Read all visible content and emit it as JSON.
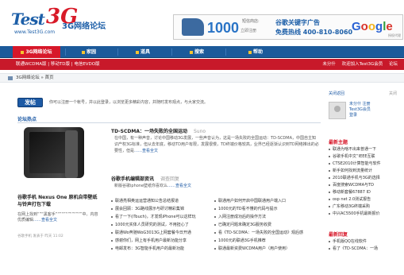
{
  "header": {
    "logo_main": "Test",
    "logo_x": "3G",
    "logo_url": "www.Test3G.com",
    "site_title": "3G网络论坛"
  },
  "banner": {
    "big_number": "1000",
    "tag_top": "短信商店:",
    "tag_bottom": "立即注册",
    "google_title": "谷歌关键字广告",
    "hotline": "免费热线 400-810-8060",
    "google_sub": "授权代理"
  },
  "nav": {
    "items": [
      "3G网络论坛",
      "家园",
      "道具",
      "搜索",
      "帮助"
    ],
    "active_index": 0
  },
  "subnav": {
    "left": "联通WCDMA版 | 移动TD版 | 电信EVDO版",
    "right_items": [
      "未分什",
      "欢迎加入Test3G会员",
      "论坛"
    ]
  },
  "breadcrumb": {
    "text": "3G网络论坛 » 首页"
  },
  "post": {
    "button_label": "发帖",
    "hint": "你可以注册一个帐号，并以此登录，以浏览更多精彩内容，并随时发布观点，与大家交流。"
  },
  "hot_section": {
    "title": "论坛热点"
  },
  "featured": {
    "title": "谷歌手机 Nexus One 原机自带壁纸与铃声打包下载",
    "description": "在网上找到“”“黑客手”“”“”“”“”“”“”中。内容优质编辑",
    "more": "……查看全文",
    "meta": "谷歌手机  发表于 昨天 11:02"
  },
  "news1": {
    "title": "TD-SCDMA：一场失败的全国运动",
    "source": "Suno",
    "body": "在中国，有一种声音，讨论中国移动3G发展，一些声音认为，这是一场失败的全国运动：TD-SCDMA，中国自主知识产权3G标准，但从去年底，移动TD用户有限，发展很慢，TD终端价格较高，业界已经逐渐认识到TD网络推出的必要性，但是",
    "link": "……查看全文"
  },
  "news2": {
    "title": "谷歌手机编辑部资讯",
    "source": "调查回复",
    "body": "新版谷歌iphone壁纸你喜欢么",
    "link": "……查看全文"
  },
  "list_left": [
    "联通亮相奥运运营通知公告总结报道",
    "展会回顾：3G路线展示与研讨精彩集锦",
    "看了一下(iTouch)，才发现iPhone可以这样玩",
    "1000元实体人员研究的测试，不用担心了",
    "联通Wo奔驰WoG3013G上网套餐今日开通",
    "感谢你们，网上有手机用户最新功能分享",
    "电邮发布：3G智能手机用户的最新功能"
  ],
  "list_right": [
    "联通用户如何开启中国联通用户端入口",
    "1000元的TD看不懂的代码与提示",
    "入网注册成功后的操作方法",
    "已确定问题未确定3G服务收费",
    "看《TD-SCDMA：一场失败的全国运动》观后感",
    "1000元的联通3G手机推荐",
    "联通最新资费WCDMA用户（用户使用）"
  ],
  "sidebar": {
    "top_label": "关闭返回",
    "close": "关闭",
    "user_lines": [
      "未分什 注册",
      "Test3G会员",
      "登录"
    ],
    "heading1": "最新主题",
    "topics": [
      "联通为啥不出来普通一下",
      "谷歌手机中文“IEEE互联",
      "CTSE2010计算智能与软件",
      "新手如何找到流量统计",
      "2010联通手机与3G的选择",
      "百度搜索WCDMA与TD",
      "移动新套餐67887 ID",
      "osp net 2.0测试报告",
      "广东移动3G终端采购",
      "中兴AC5500手机最新报价"
    ],
    "heading2": "最新回复",
    "replies": [
      "手机版QQ在线软件",
      "看了《TD-SCDMA：一场"
    ]
  }
}
